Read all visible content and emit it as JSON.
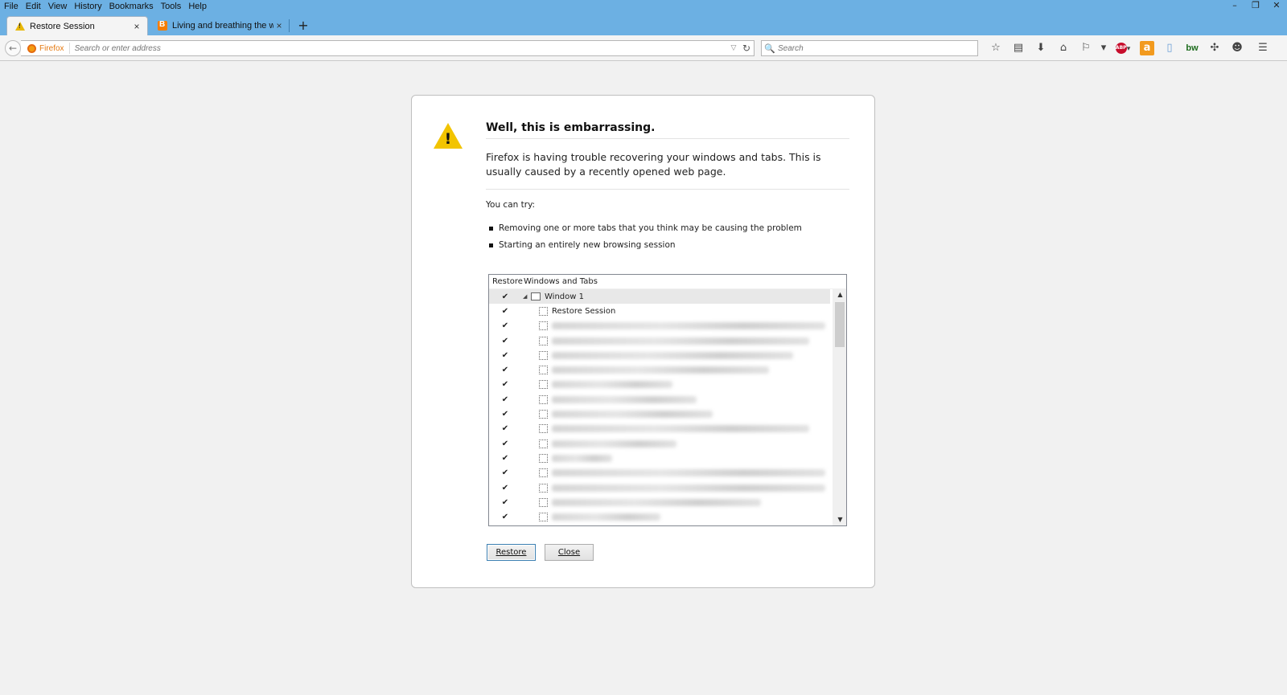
{
  "menu": [
    "File",
    "Edit",
    "View",
    "History",
    "Bookmarks",
    "Tools",
    "Help"
  ],
  "window_controls": {
    "minimize": "–",
    "restore": "❐",
    "close": "✕"
  },
  "tabs": [
    {
      "label": "Restore Session",
      "icon": "warning-icon",
      "close": "×"
    },
    {
      "label": "Living and breathing the w...",
      "icon": "blogger-icon",
      "close": "×"
    }
  ],
  "new_tab": "+",
  "nav": {
    "back": "←",
    "identity": "Firefox",
    "url_placeholder": "Search or enter address",
    "dropdown": "▽",
    "reload": "↻",
    "search_icon": "🔍",
    "search_placeholder": "Search"
  },
  "toolbar_icons": [
    "star-icon",
    "reading-list-icon",
    "download-icon",
    "home-icon",
    "extension-icon",
    "dropdown-icon",
    "adblock-icon",
    "amazon-icon",
    "notes-icon",
    "bw-icon",
    "extension-2-icon",
    "chat-icon",
    "menu-icon"
  ],
  "toolbar_glyphs": {
    "star": "☆",
    "list": "▤",
    "download": "⬇",
    "home": "⌂",
    "ext": "⚐",
    "drop": "▾",
    "abp": "ABP",
    "abp_drop": "▾",
    "amazon": "a",
    "notes": "▯",
    "bw": "bw",
    "ext2": "✣",
    "chat": "☻",
    "menu": "☰"
  },
  "dialog": {
    "warn_mark": "!",
    "heading": "Well, this is embarrassing.",
    "message": "Firefox is having trouble recovering your windows and tabs. This is usually caused by a recently opened web page.",
    "try_label": "You can try:",
    "suggestions": [
      "Removing one or more tabs that you think may be causing the problem",
      "Starting an entirely new browsing session"
    ],
    "tree": {
      "col_restore": "Restore",
      "col_windows": "Windows and Tabs",
      "check": "✔",
      "window_row": {
        "label": "Window 1",
        "twisty": "◢"
      },
      "first_tab": "Restore Session"
    },
    "scroll_up": "▲",
    "scroll_down": "▼",
    "restore_button": "Restore",
    "close_button": "Close"
  }
}
